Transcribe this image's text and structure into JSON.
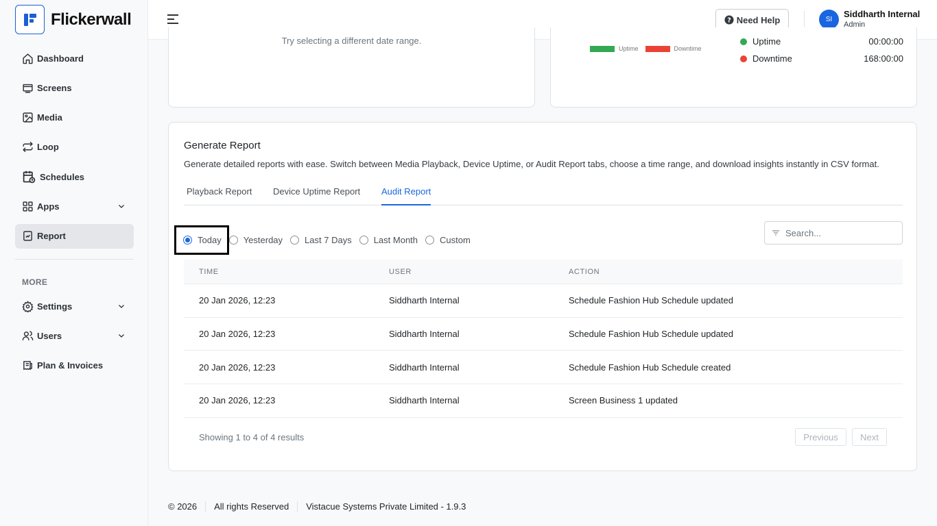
{
  "brand": {
    "name": "Flickerwall"
  },
  "sidebar": {
    "items": [
      {
        "label": "Dashboard"
      },
      {
        "label": "Screens"
      },
      {
        "label": "Media"
      },
      {
        "label": "Loop"
      },
      {
        "label": "Schedules"
      },
      {
        "label": "Apps"
      },
      {
        "label": "Report"
      }
    ],
    "more_label": "MORE",
    "more_items": [
      {
        "label": "Settings"
      },
      {
        "label": "Users"
      },
      {
        "label": "Plan & Invoices"
      }
    ]
  },
  "header": {
    "help_label": "Need Help",
    "avatar_initials": "SI",
    "user_name": "Siddharth Internal",
    "user_role": "Admin"
  },
  "playback_card": {
    "empty_hint": "Try selecting a different date range."
  },
  "uptime_card": {
    "legend": [
      {
        "label": "Uptime",
        "color": "#34a853"
      },
      {
        "label": "Downtime",
        "color": "#ea4335"
      }
    ],
    "stats": [
      {
        "label": "Uptime",
        "value": "00:00:00",
        "color": "#34a853"
      },
      {
        "label": "Downtime",
        "value": "168:00:00",
        "color": "#ea4335"
      }
    ]
  },
  "report": {
    "title": "Generate Report",
    "description": "Generate detailed reports with ease. Switch between Media Playback, Device Uptime, or Audit Report tabs, choose a time range, and download insights instantly in CSV format.",
    "tabs": [
      {
        "label": "Playback Report"
      },
      {
        "label": "Device Uptime Report"
      },
      {
        "label": "Audit Report"
      }
    ],
    "ranges": [
      {
        "label": "Today"
      },
      {
        "label": "Yesterday"
      },
      {
        "label": "Last 7 Days"
      },
      {
        "label": "Last Month"
      },
      {
        "label": "Custom"
      }
    ],
    "search_placeholder": "Search...",
    "columns": {
      "time": "TIME",
      "user": "USER",
      "action": "ACTION"
    },
    "rows": [
      {
        "time": "20 Jan 2026, 12:23",
        "user": "Siddharth Internal",
        "action": "Schedule Fashion Hub Schedule updated"
      },
      {
        "time": "20 Jan 2026, 12:23",
        "user": "Siddharth Internal",
        "action": "Schedule Fashion Hub Schedule updated"
      },
      {
        "time": "20 Jan 2026, 12:23",
        "user": "Siddharth Internal",
        "action": "Schedule Fashion Hub Schedule created"
      },
      {
        "time": "20 Jan 2026, 12:23",
        "user": "Siddharth Internal",
        "action": "Screen Business 1 updated"
      }
    ],
    "results_info": "Showing 1 to 4 of 4 results",
    "previous_label": "Previous",
    "next_label": "Next"
  },
  "footer": {
    "copyright": "© 2026",
    "rights": "All rights Reserved",
    "company": "Vistacue Systems Private Limited - 1.9.3"
  }
}
